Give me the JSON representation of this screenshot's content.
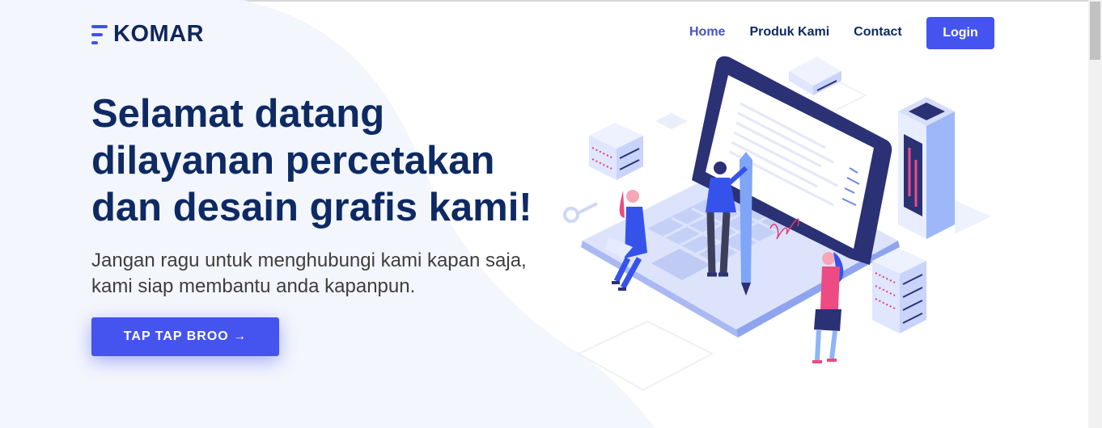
{
  "brand": {
    "name": "KOMAR"
  },
  "nav": {
    "items": [
      "Home",
      "Produk Kami",
      "Contact"
    ],
    "login_label": "Login"
  },
  "hero": {
    "title": "Selamat datang dilayanan percetakan dan desain grafis kami!",
    "subtitle": "Jangan ragu untuk menghubungi kami kapan saja, kami siap membantu anda kapanpun.",
    "cta_label": "TAP TAP BROO →"
  },
  "colors": {
    "primary": "#4553ef",
    "heading": "#0e2a63",
    "text": "#3e3e3e",
    "background_shape": "#f4f6fd"
  },
  "illustration": {
    "icon": "laptop-people-servers-illustration"
  }
}
